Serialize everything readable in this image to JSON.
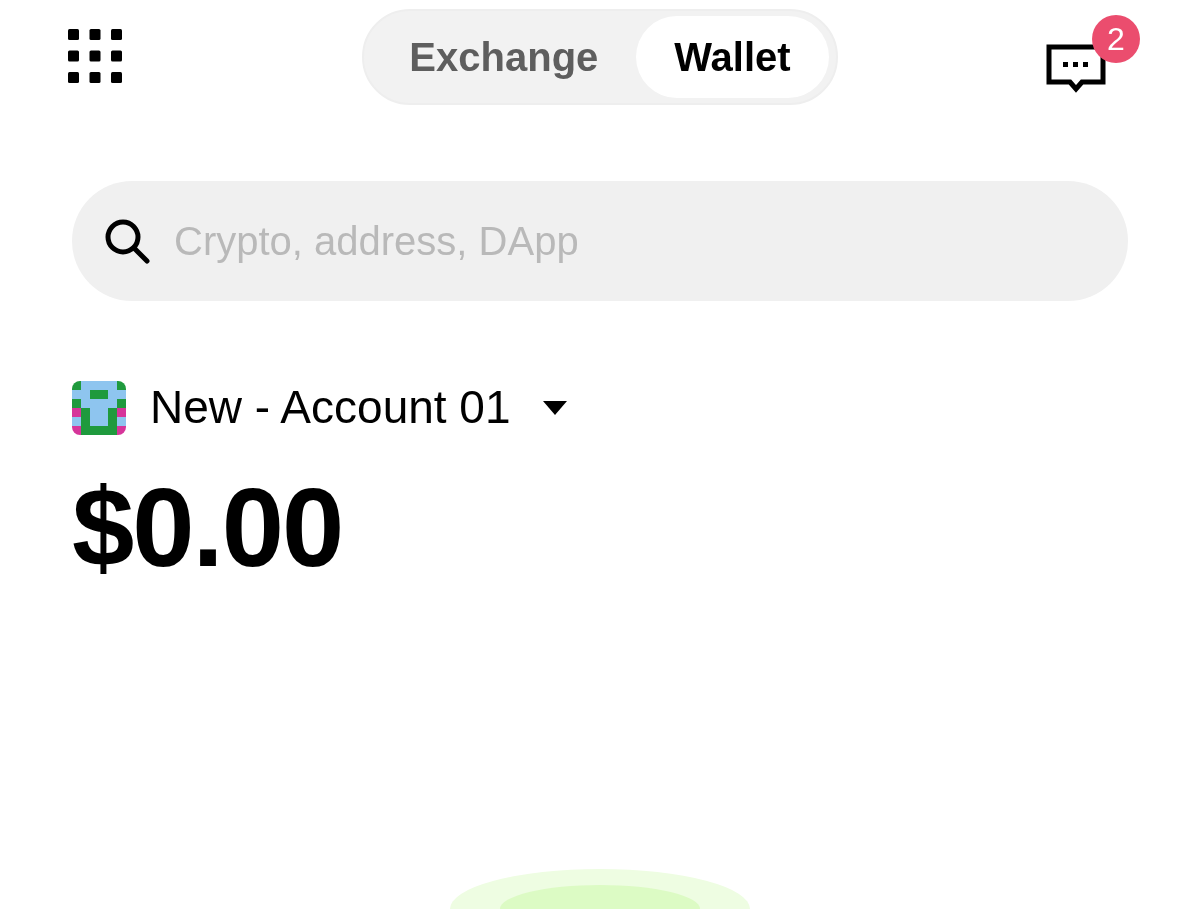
{
  "tabs": [
    {
      "label": "Exchange",
      "selected": false
    },
    {
      "label": "Wallet",
      "selected": true
    }
  ],
  "messages": {
    "badge": "2"
  },
  "search": {
    "placeholder": "Crypto, address, DApp"
  },
  "account": {
    "name": "New - Account 01"
  },
  "balance": "$0.00"
}
